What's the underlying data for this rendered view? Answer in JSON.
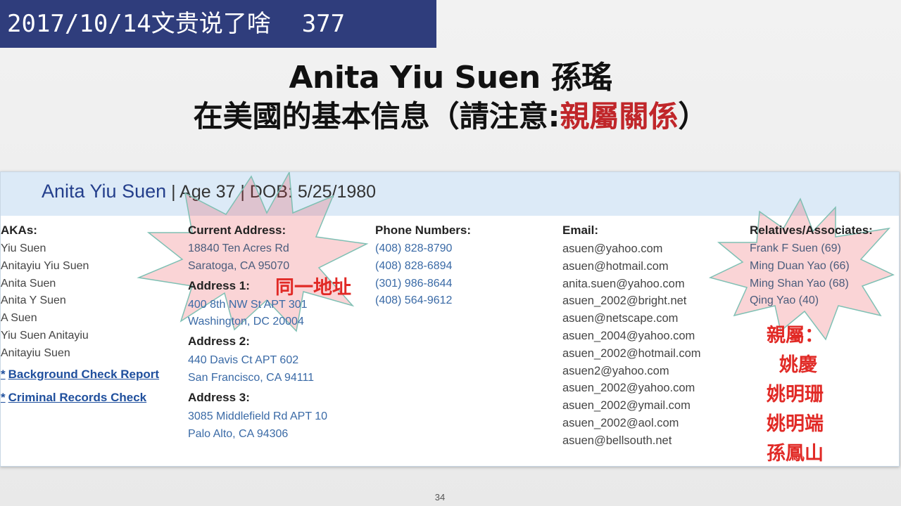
{
  "banner": {
    "date_title": "2017/10/14文贵说了啥",
    "episode": "377"
  },
  "slide": {
    "title_line1": "Anita Yiu Suen 孫瑤",
    "title_line2_prefix": "在美國的基本信息（請注意:",
    "title_line2_highlight": "親屬關係",
    "title_line2_suffix": "）",
    "page_number": "34"
  },
  "profile": {
    "name": "Anita Yiu Suen",
    "sep1": " | ",
    "age": "Age 37",
    "sep2": " | ",
    "dob": "DOB: 5/25/1980"
  },
  "akas": {
    "header": "AKAs:",
    "items": [
      "Yiu Suen",
      "Anitayiu Yiu Suen",
      "Anita Suen",
      "Anita Y Suen",
      "A Suen",
      "Yiu Suen Anitayiu",
      "Anitayiu Suen"
    ],
    "links": [
      {
        "bullet": "*",
        "label": "Background Check Report"
      },
      {
        "bullet": "*",
        "label": "Criminal Records Check"
      }
    ]
  },
  "addresses": {
    "current_header": "Current Address:",
    "current": [
      "18840 Ten Acres Rd",
      "Saratoga, CA 95070"
    ],
    "addr1_header": "Address 1:",
    "addr1": [
      "400 8th NW St APT 301",
      "Washington, DC 20004"
    ],
    "addr2_header": "Address 2:",
    "addr2": [
      "440 Davis Ct APT 602",
      "San Francisco, CA 94111"
    ],
    "addr3_header": "Address 3:",
    "addr3": [
      "3085 Middlefield Rd APT 10",
      "Palo Alto, CA 94306"
    ]
  },
  "phones": {
    "header": "Phone Numbers:",
    "items": [
      "(408) 828-8790",
      "(408) 828-6894",
      "(301) 986-8644",
      "(408) 564-9612"
    ]
  },
  "emails": {
    "header": "Email:",
    "items": [
      "asuen@yahoo.com",
      "asuen@hotmail.com",
      "anita.suen@yahoo.com",
      "asuen_2002@bright.net",
      "asuen@netscape.com",
      "asuen_2004@yahoo.com",
      "asuen_2002@hotmail.com",
      "asuen2@yahoo.com",
      "asuen_2002@yahoo.com",
      "asuen_2002@ymail.com",
      "asuen_2002@aol.com",
      "asuen@bellsouth.net"
    ]
  },
  "relatives": {
    "header": "Relatives/Associates:",
    "items": [
      "Frank F Suen (69)",
      "Ming Duan Yao (66)",
      "Ming Shan Yao (68)",
      "Qing Yao (40)"
    ]
  },
  "annotations": {
    "same_address": "同一地址",
    "relatives_title": "親屬：",
    "relatives_names": [
      "姚慶",
      "姚明珊",
      "姚明端",
      "孫鳳山"
    ]
  },
  "colors": {
    "banner_bg": "#2f3d7c",
    "highlight_red": "#e12a26",
    "link_blue": "#1f4f9d",
    "header_band": "#dceaf7"
  }
}
